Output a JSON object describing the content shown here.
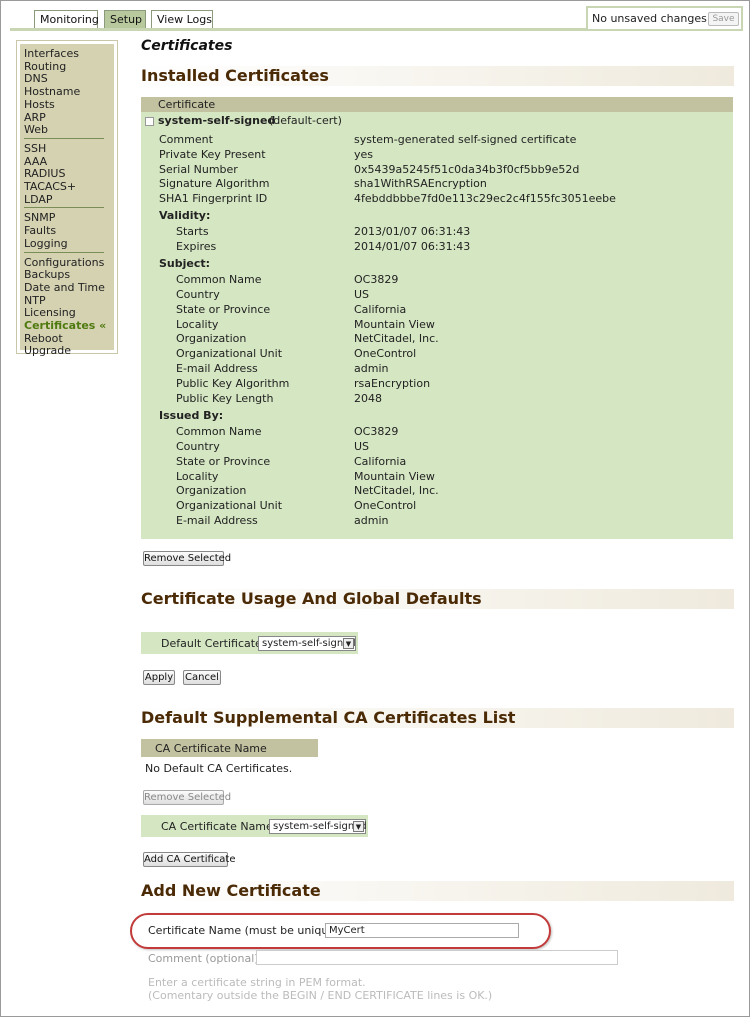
{
  "tabs": [
    {
      "label": "Monitoring"
    },
    {
      "label": "Setup"
    },
    {
      "label": "View Logs"
    }
  ],
  "status": {
    "text": "No unsaved changes",
    "save_label": "Save"
  },
  "nav": {
    "groups": [
      [
        "Interfaces",
        "Routing",
        "DNS",
        "Hostname",
        "Hosts",
        "ARP",
        "Web"
      ],
      [
        "SSH",
        "AAA",
        "RADIUS",
        "TACACS+",
        "LDAP"
      ],
      [
        "SNMP",
        "Faults",
        "Logging"
      ],
      [
        "Configurations",
        "Backups",
        "Date and Time",
        "NTP",
        "Licensing",
        "Certificates «",
        "Reboot",
        "Upgrade"
      ]
    ],
    "active": "Certificates «"
  },
  "page_title": "Certificates",
  "installed": {
    "heading": "Installed Certificates",
    "column_header": "Certificate",
    "cert_name": "system-self-signed",
    "cert_tag": "(default-cert)",
    "fields": [
      {
        "label": "Comment",
        "value": "system-generated self-signed certificate"
      },
      {
        "label": "Private Key Present",
        "value": "yes"
      },
      {
        "label": "Serial Number",
        "value": "0x5439a5245f51c0da34b3f0cf5bb9e52d"
      },
      {
        "label": "Signature Algorithm",
        "value": "sha1WithRSAEncryption"
      },
      {
        "label": "SHA1 Fingerprint ID",
        "value": "4febddbbbe7fd0e113c29ec2c4f155fc3051eebe"
      }
    ],
    "validity": {
      "label": "Validity:",
      "fields": [
        {
          "label": "Starts",
          "value": "2013/01/07 06:31:43"
        },
        {
          "label": "Expires",
          "value": "2014/01/07 06:31:43"
        }
      ]
    },
    "subject": {
      "label": "Subject:",
      "fields": [
        {
          "label": "Common Name",
          "value": "OC3829"
        },
        {
          "label": "Country",
          "value": "US"
        },
        {
          "label": "State or Province",
          "value": "California"
        },
        {
          "label": "Locality",
          "value": "Mountain View"
        },
        {
          "label": "Organization",
          "value": "NetCitadel, Inc."
        },
        {
          "label": "Organizational Unit",
          "value": "OneControl"
        },
        {
          "label": "E-mail Address",
          "value": "admin"
        },
        {
          "label": "Public Key Algorithm",
          "value": "rsaEncryption"
        },
        {
          "label": "Public Key Length",
          "value": "2048"
        }
      ]
    },
    "issued_by": {
      "label": "Issued By:",
      "fields": [
        {
          "label": "Common Name",
          "value": "OC3829"
        },
        {
          "label": "Country",
          "value": "US"
        },
        {
          "label": "State or Province",
          "value": "California"
        },
        {
          "label": "Locality",
          "value": "Mountain View"
        },
        {
          "label": "Organization",
          "value": "NetCitadel, Inc."
        },
        {
          "label": "Organizational Unit",
          "value": "OneControl"
        },
        {
          "label": "E-mail Address",
          "value": "admin"
        }
      ]
    },
    "remove_label": "Remove Selected"
  },
  "usage": {
    "heading": "Certificate Usage And Global Defaults",
    "default_label": "Default Certificate",
    "default_value": "system-self-signed",
    "apply_label": "Apply",
    "cancel_label": "Cancel"
  },
  "supplemental": {
    "heading": "Default Supplemental CA Certificates List",
    "column_header": "CA Certificate Name",
    "empty_text": "No Default CA Certificates.",
    "remove_label": "Remove Selected",
    "ca_label": "CA Certificate Name",
    "ca_value": "system-self-signed",
    "add_label": "Add CA Certificate"
  },
  "add_new": {
    "heading": "Add New Certificate",
    "name_label": "Certificate Name (must be unique):",
    "name_value": "MyCert",
    "comment_label": "Comment (optional):",
    "comment_value": "",
    "pem_hint_1": "Enter a certificate string in PEM format.",
    "pem_hint_2": "(Comentary outside the BEGIN / END CERTIFICATE lines is OK.)"
  }
}
